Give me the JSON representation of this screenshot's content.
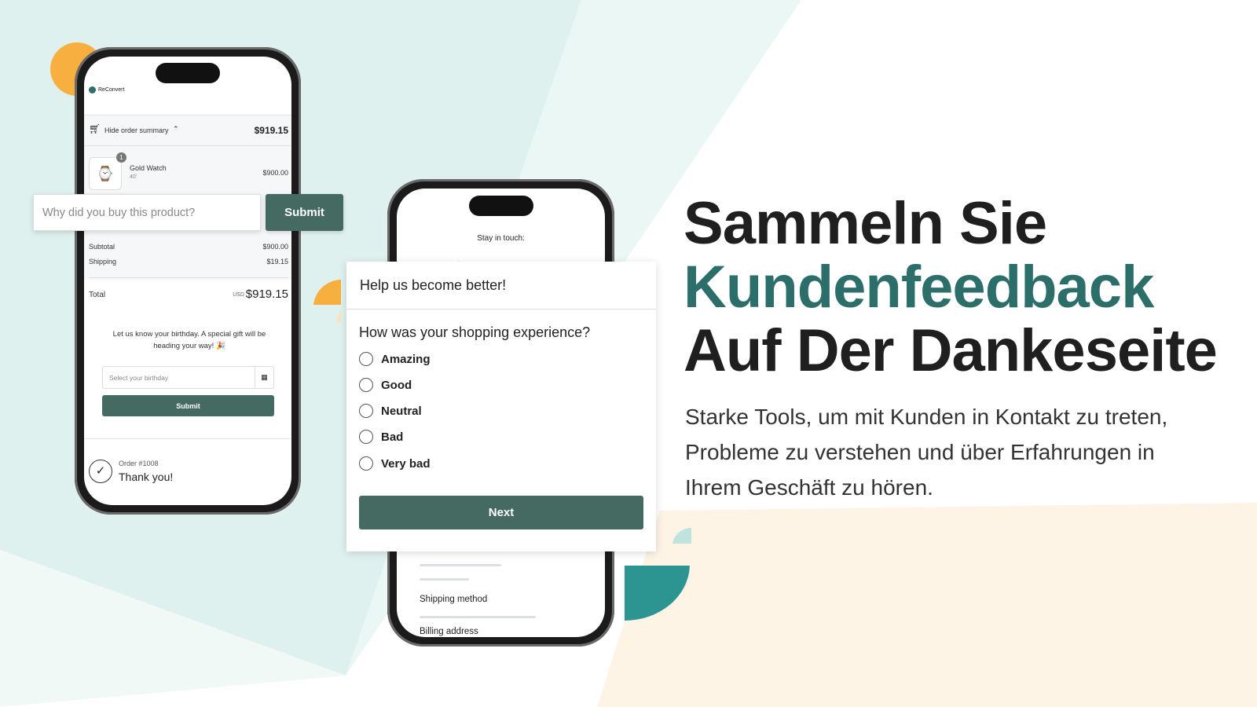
{
  "colors": {
    "accent": "#2b6e6a",
    "button": "#456a62",
    "bg_teal": "#dff1ee",
    "bg_beige": "#fdf4e6",
    "orange": "#f7b040",
    "teal_shape": "#2c9591"
  },
  "phone1": {
    "brand": "ReConvert",
    "order_summary_toggle": "Hide order summary",
    "order_total": "$919.15",
    "item": {
      "qty": "1",
      "name": "Gold Watch",
      "variant": "40'",
      "price": "$900.00"
    },
    "subtotal_label": "Subtotal",
    "subtotal": "$900.00",
    "shipping_label": "Shipping",
    "shipping": "$19.15",
    "total_label": "Total",
    "currency": "USD",
    "total": "$919.15",
    "birthday_text": "Let us know your birthday. A special gift will be heading your way! 🎉",
    "birthday_placeholder": "Select your birthday",
    "birthday_submit": "Submit",
    "order_number": "Order #1008",
    "thank_you": "Thank you!"
  },
  "feedback_input": {
    "placeholder": "Why did you buy this product?",
    "submit": "Submit"
  },
  "phone2": {
    "stay_in_touch": "Stay in touch:",
    "social": [
      "facebook-icon",
      "twitter-icon",
      "pinterest-icon",
      "linkedin-icon",
      "google-plus-icon"
    ],
    "shipping_method": "Shipping method",
    "billing_address": "Billing address"
  },
  "survey": {
    "title": "Help us become better!",
    "question": "How was your shopping experience?",
    "options": [
      "Amazing",
      "Good",
      "Neutral",
      "Bad",
      "Very bad"
    ],
    "next": "Next"
  },
  "hero": {
    "line1": "Sammeln Sie",
    "line2": "Kundenfeedback",
    "line3": "Auf Der Dankeseite",
    "description": "Starke Tools, um mit Kunden in Kontakt zu treten, Probleme zu verstehen und über Erfahrungen in Ihrem Geschäft zu hören."
  }
}
